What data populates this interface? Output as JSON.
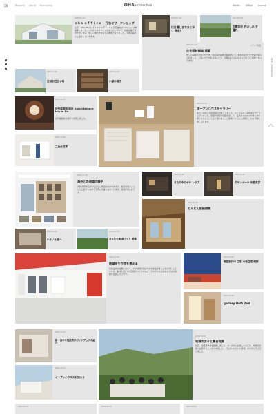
{
  "header": {
    "lang": "EN",
    "nav": [
      "Projects",
      "About",
      "Recruiting"
    ],
    "logo_bold": "OHA",
    "logo_light": "architecture",
    "right_nav": [
      "Works",
      "Office",
      "Journal"
    ]
  },
  "side_tag": "OHA · Architecture",
  "cards": {
    "c1": {
      "date": "2023.01.16",
      "title": "ｏｈａ ｏｆｆｉｃｅ 　打合せワークショップ",
      "text": "先日、OHAofficeにてｏｈａ ｏｆｆｉｃｅの打合せワークショップを開催しました。これからのオフィスのあり方について、社員全員で意見を出し合い、新しい働き方を考える機会となりました。今後の設計にも活かしていきます。"
    },
    "c2": {
      "date": "2023.01.10",
      "title": "引き渡しまであと少し 週末！"
    },
    "c3": {
      "date": "2023.01.08",
      "title": "大樹の杜 白いし水 夕暮れ"
    },
    "c4": {
      "date": "2023.01.05",
      "tag": "メディア掲載",
      "title": "住宅設計雑誌 掲載",
      "text": "新しい掲載のお知らせです。住宅設計雑誌の最新号にて、弊社の手がけた作品が紹介されました。ご覧いただければ幸いです。今後もより良い住まいづくりに努めてまいります。"
    },
    "c5": {
      "date": "2022.12.22",
      "title": "白浜別荘白ヶ崎"
    },
    "c6": {
      "date": "2022.12.20",
      "title": "小屋の様子"
    },
    "c7": {
      "date": "2022.12.15",
      "title": "近代美術館 展示 #architecture trip in Ha...",
      "text": "近代美術館の展示を見学しました。"
    },
    "c8": {
      "date": "2022.12.12",
      "title": "オープンハウスギャラリー",
      "text": "先日ご案内した模型展示が終了しました。たくさんのご来場ありがとうございました。建築の模型や図面を通して、設計のプロセスや考え方を感じていただけたかと思います。ご来場いただいた皆様に、心より御礼申し上げます。"
    },
    "c9": {
      "date": "2022.12.08",
      "title": "二台分駐車"
    },
    "c10": {
      "date": "2022.11.30",
      "title": "海外との現場の様子",
      "text": "海外の現場ではやりとりに時間がかかりますが、地元の職人さんたちと協力しながら丁寧に作業を進めています。完成が楽しみです。"
    },
    "c11": {
      "date": "2022.11.28",
      "title": "まちの中のセサ ンクス"
    },
    "c12": {
      "date": "2022.11.25",
      "title": "グランドーケ 中庭見学"
    },
    "c13": {
      "date": "2022.11.20",
      "title": "どんどん仮納期間"
    },
    "c14": {
      "date": "2022.11.15",
      "title": "いよいよ足へ"
    },
    "c15": {
      "date": "2022.11.12",
      "title": "あなたを海  庭づくり 現場"
    },
    "c16": {
      "date": "2022.11.08",
      "title": "地域を生かすを考える",
      "text": "建築設計の仕事において、その地域の風土や文化を生かすことを大切にしています。素材の選び方や空間のつくり方など、それぞれの土地ならではの建築を目指しています。"
    },
    "c17": {
      "date": "2022.11.02",
      "title": "現在進行中 工場 木造住宅 増築"
    },
    "c18": {
      "date": "2022.10.28",
      "title": "gallery OHA 2nd"
    },
    "c19": {
      "date": "2022.10.20",
      "title": "新・省エネ性能表示ガイドブックの紹介"
    },
    "c20": {
      "date": "2022.10.18",
      "title": "地域の方々と集合写真",
      "text": "先日、完成見学会を開催しました。多くの方にお越しいただき、地域の皆様と交流することができました。ご協力いただいた皆様、ありがとうございました。"
    },
    "c21": {
      "date": "2022.10.15",
      "title": "オープンハウスのお知らせ"
    }
  },
  "footer_dates": [
    "2022.10.10",
    "2022.10.05",
    "2022.10.01"
  ],
  "colors": {
    "card_bg": "#e6e6e6",
    "page_bg": "#ffffff",
    "text": "#222222"
  }
}
